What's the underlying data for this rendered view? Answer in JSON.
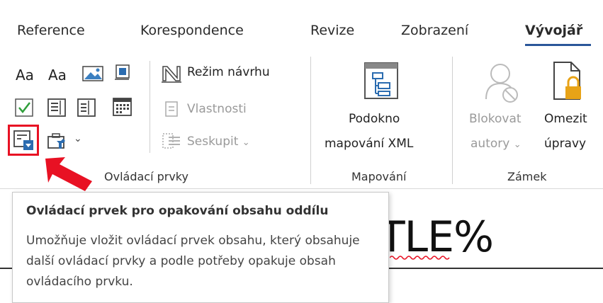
{
  "tabs": [
    "Reference",
    "Korespondence",
    "Revize",
    "Zobrazení",
    "Vývojář"
  ],
  "ribbon": {
    "controls_group": {
      "label": "Ovládací prvky",
      "design_mode_label": "Režim návrhu",
      "properties_label": "Vlastnosti",
      "group_label": "Seskupit",
      "aa1": "Aa",
      "aa2": "Aa"
    },
    "mapping_group": {
      "label": "Mapování",
      "xml_pane_line1": "Podokno",
      "xml_pane_line2": "mapování XML"
    },
    "lock_group": {
      "label": "Zámek",
      "block_authors_line1": "Blokovat",
      "block_authors_line2": "autory",
      "restrict_editing_line1": "Omezit",
      "restrict_editing_line2": "úpravy"
    }
  },
  "document": {
    "visible_text": "TLE%"
  },
  "tooltip": {
    "title": "Ovládací prvek pro opakování obsahu oddílu",
    "body": "Umožňuje vložit ovládací prvek obsahu, který obsahuje další ovládací prvky a podle potřeby opakuje obsah ovládacího prvku."
  },
  "colors": {
    "accent": "#2b579a",
    "highlight_border": "#e81123",
    "arrow": "#e81123",
    "checkbox_green": "#2e9e3a",
    "lock_gold": "#e8a317"
  },
  "icons": [
    "text-aa-icon",
    "plain-text-aa-icon",
    "picture-icon",
    "building-block-icon",
    "design-mode-icon",
    "checkbox-icon",
    "combo-box-icon",
    "dropdown-list-icon",
    "date-picker-icon",
    "properties-icon",
    "repeating-section-icon",
    "legacy-tools-icon",
    "group-icon",
    "xml-mapping-icon",
    "block-authors-icon",
    "restrict-editing-icon",
    "red-arrow-icon"
  ]
}
